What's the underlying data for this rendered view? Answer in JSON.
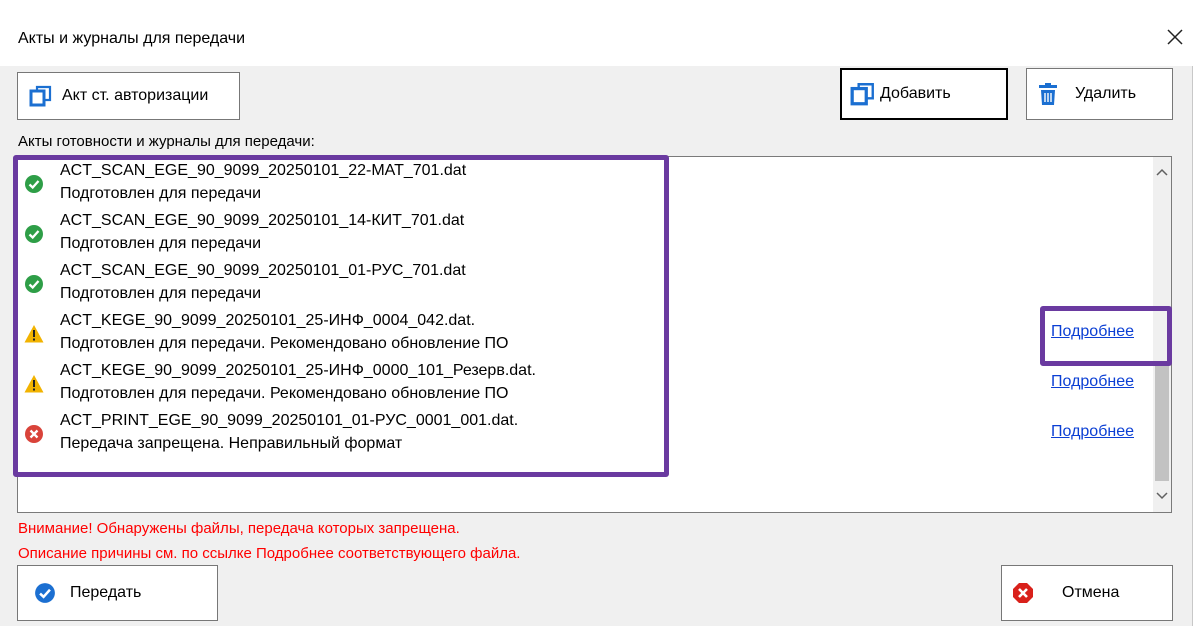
{
  "window": {
    "title": "Акты и журналы для передачи",
    "close_glyph": "✕"
  },
  "toolbar": {
    "auth_act_label": "Акт ст. авторизации",
    "add_label": "Добавить",
    "delete_label": "Удалить"
  },
  "list": {
    "label": "Акты готовности и журналы для передачи:",
    "items": [
      {
        "file": "ACT_SCAN_EGE_90_9099_20250101_22-МАТ_701.dat",
        "status": "Подготовлен для передачи",
        "icon": "success-icon",
        "link": ""
      },
      {
        "file": "ACT_SCAN_EGE_90_9099_20250101_14-КИТ_701.dat",
        "status": "Подготовлен для передачи",
        "icon": "success-icon",
        "link": ""
      },
      {
        "file": "ACT_SCAN_EGE_90_9099_20250101_01-РУС_701.dat",
        "status": "Подготовлен для передачи",
        "icon": "success-icon",
        "link": ""
      },
      {
        "file": "ACT_KEGE_90_9099_20250101_25-ИНФ_0004_042.dat.",
        "status": "Подготовлен для передачи. Рекомендовано обновление ПО",
        "icon": "warning-icon",
        "link": "Подробнее"
      },
      {
        "file": "ACT_KEGE_90_9099_20250101_25-ИНФ_0000_101_Резерв.dat.",
        "status": "Подготовлен для передачи. Рекомендовано обновление ПО",
        "icon": "warning-icon",
        "link": "Подробнее"
      },
      {
        "file": "ACT_PRINT_EGE_90_9099_20250101_01-РУС_0001_001.dat.",
        "status": "Передача запрещена. Неправильный формат",
        "icon": "error-icon",
        "link": "Подробнее"
      }
    ]
  },
  "warnings": {
    "line1": "Внимание! Обнаружены файлы, передача которых запрещена.",
    "line2": "Описание причины см. по ссылке Подробнее соответствующего файла."
  },
  "footer": {
    "send_label": "Передать",
    "cancel_label": "Отмена"
  },
  "colors": {
    "highlight": "#6a3aa0",
    "link": "#0b3fd4",
    "warning_text": "#ff0000",
    "success": "#2e9e47",
    "error": "#d9433a",
    "warning": "#f2b300",
    "accent_blue": "#1b6fd1"
  }
}
